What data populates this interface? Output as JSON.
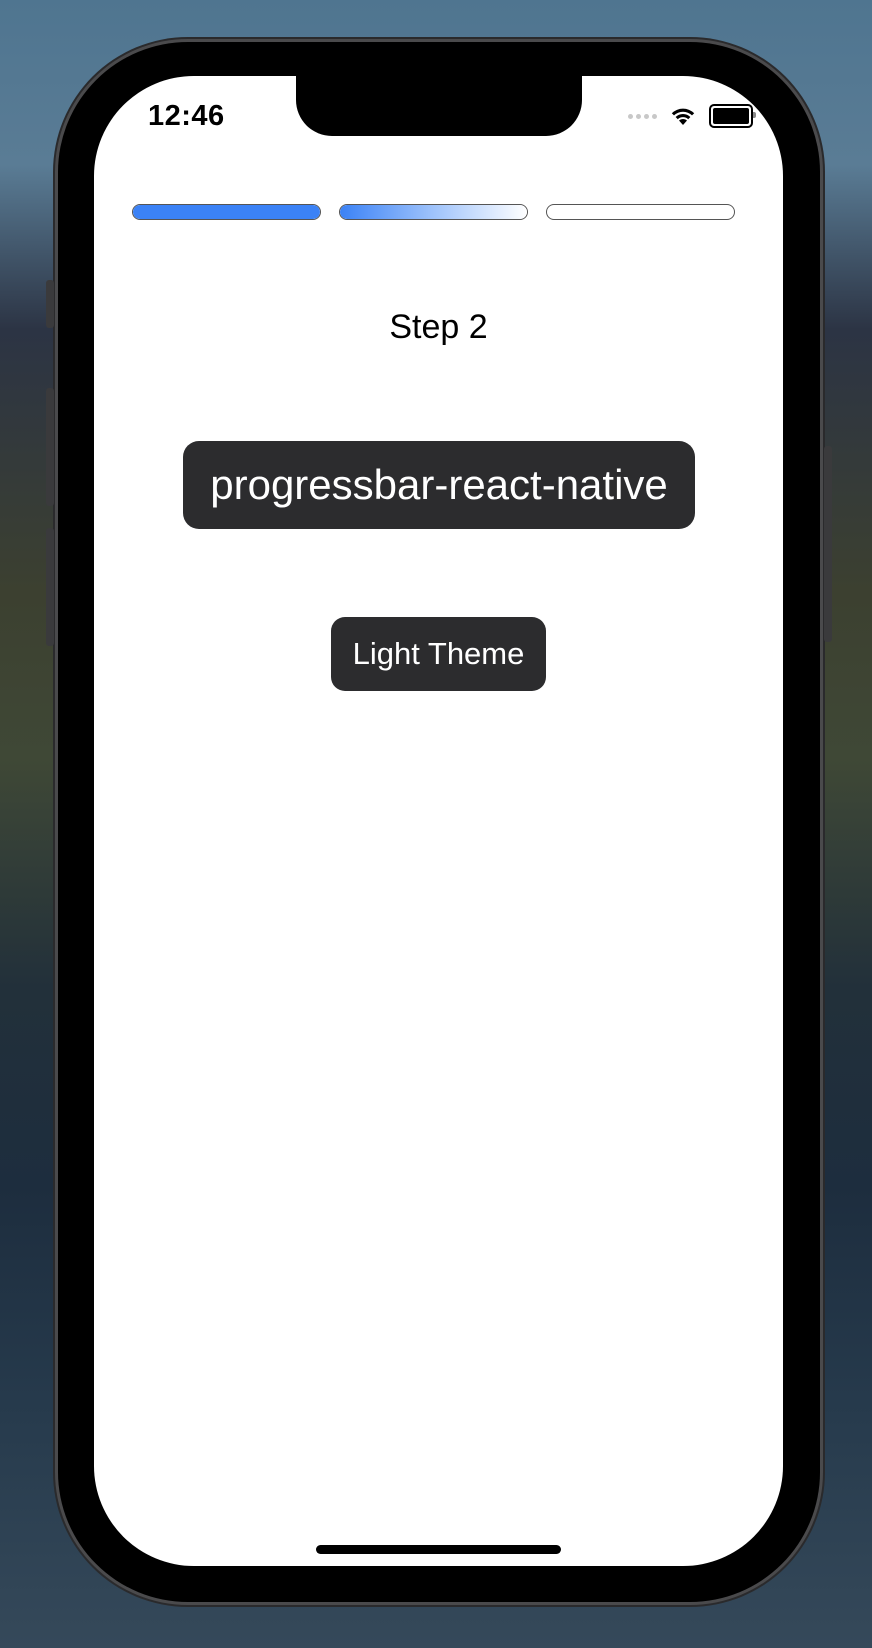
{
  "status_bar": {
    "time": "12:46"
  },
  "progress": {
    "steps": 3,
    "segments": [
      {
        "progress": 1.0,
        "state": "complete",
        "color": "#3b82f6"
      },
      {
        "progress": 0.5,
        "state": "active",
        "color": "#3b82f6"
      },
      {
        "progress": 0.0,
        "state": "pending",
        "color": "#ffffff"
      }
    ]
  },
  "main": {
    "step_label": "Step 2",
    "title": "progressbar-react-native",
    "theme_button_label": "Light Theme"
  }
}
